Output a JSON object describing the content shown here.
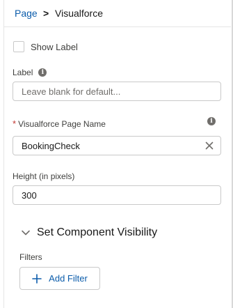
{
  "breadcrumb": {
    "parent": "Page",
    "separator": ">",
    "current": "Visualforce"
  },
  "show_label": {
    "label": "Show Label",
    "checked": false
  },
  "label_field": {
    "label": "Label",
    "placeholder": "Leave blank for default...",
    "value": ""
  },
  "page_name_field": {
    "required_marker": "*",
    "label": "Visualforce Page Name",
    "value": "BookingCheck"
  },
  "height_field": {
    "label": "Height (in pixels)",
    "value": "300"
  },
  "visibility_section": {
    "title": "Set Component Visibility",
    "filters_label": "Filters",
    "add_filter_label": "Add Filter"
  },
  "colors": {
    "link": "#0b5cab",
    "required": "#c23934",
    "border": "#c9c9c9"
  }
}
